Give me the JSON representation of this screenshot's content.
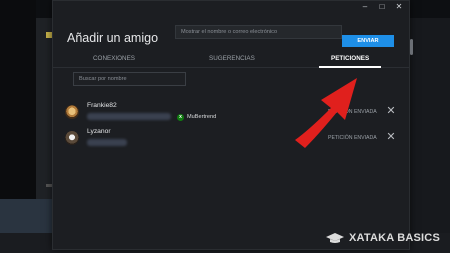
{
  "window": {
    "minimize": "–",
    "maximize": "□",
    "close": "✕"
  },
  "dialog": {
    "title": "Añadir un amigo",
    "search_placeholder": "Mostrar el nombre o correo electrónico",
    "send_label": "ENVIAR"
  },
  "tabs": [
    {
      "label": "CONEXIONES",
      "active": false
    },
    {
      "label": "SUGERENCIAS",
      "active": false
    },
    {
      "label": "PETICIONES",
      "active": true
    }
  ],
  "filter": {
    "placeholder": "Buscar por nombre"
  },
  "requests": [
    {
      "name": "Frankie82",
      "gamertag": "MuBertrend",
      "status": "PETICIÓN ENVIADA"
    },
    {
      "name": "Lyzanor",
      "gamertag": "",
      "status": "PETICIÓN ENVIADA"
    }
  ],
  "watermark": {
    "brand": "XATAKA BASICS"
  },
  "colors": {
    "accent": "#1e8fe8",
    "arrow": "#e0201d",
    "xbox": "#107c10"
  }
}
